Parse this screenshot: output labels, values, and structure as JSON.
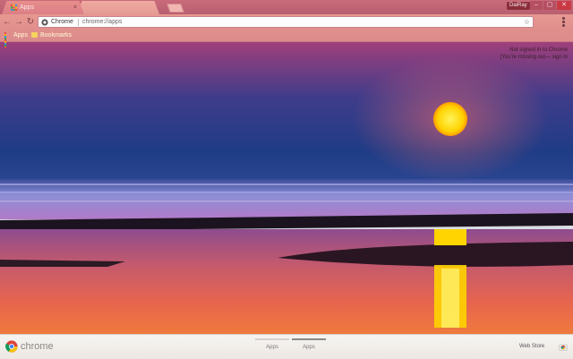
{
  "tabs": [
    {
      "label": "Apps",
      "state": "active"
    },
    {
      "label": "",
      "state": "inactive"
    }
  ],
  "window": {
    "profile_label": "DaiRay",
    "minimize_glyph": "–",
    "maximize_glyph": "▢",
    "close_glyph": "✕"
  },
  "toolbar": {
    "back_glyph": "←",
    "forward_glyph": "→",
    "reload_glyph": "↻",
    "omnibox_chip": "Chrome",
    "omnibox_url": "chrome://apps",
    "star_glyph": "☆"
  },
  "bookmarks": {
    "apps_label": "Apps",
    "bookmarks_label": "Bookmarks"
  },
  "signin": {
    "line1": "Not signed in to Chrome",
    "line2": "(You're missing out—",
    "link": "sign in"
  },
  "bottom": {
    "brand": "chrome",
    "pages": [
      {
        "label": "Apps",
        "current": false
      },
      {
        "label": "Apps",
        "current": true
      }
    ],
    "webstore_label": "Web Store"
  },
  "icons": {
    "tab_favicon": "apps-grid-icon",
    "tab_close": "close-icon",
    "back": "back-arrow-icon",
    "forward": "forward-arrow-icon",
    "reload": "reload-icon",
    "omnibox_page": "chrome-page-icon",
    "bookmark_star": "star-icon",
    "menu": "menu-dots-icon",
    "apps_shortcut": "apps-grid-icon",
    "bookmarks_folder": "folder-icon",
    "chrome_logo": "chrome-logo-icon",
    "web_store": "web-store-icon"
  },
  "colors": {
    "tab_strip": "#c96a7a",
    "toolbar": "#e08e8c",
    "bookmark_text": "#fffbd6",
    "sun": "#ffd200"
  }
}
